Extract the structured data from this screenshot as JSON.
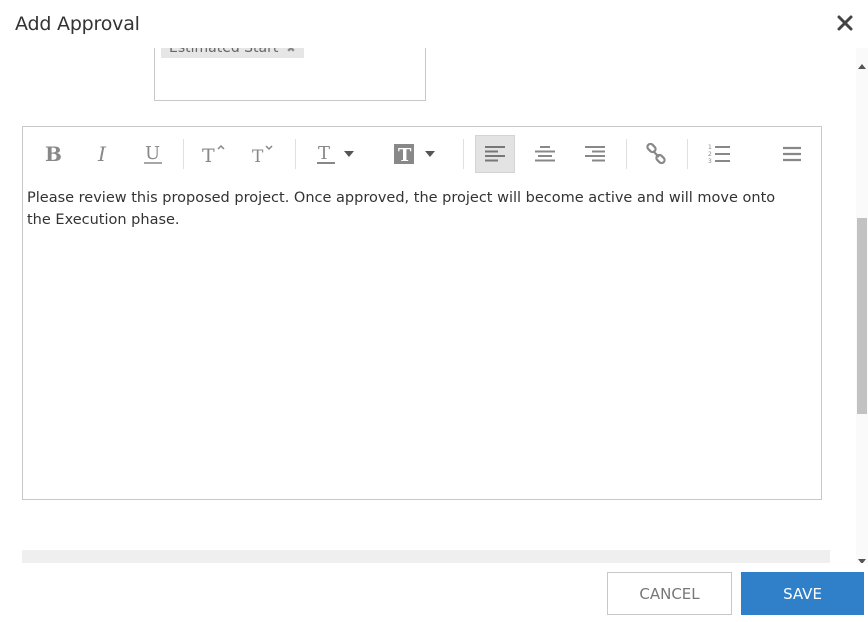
{
  "dialog": {
    "title": "Add Approval",
    "close_icon": "close-icon"
  },
  "tags": [
    {
      "label": "Estimated Start",
      "remove_icon": "close-small-icon"
    }
  ],
  "editor": {
    "toolbar": [
      {
        "name": "bold-icon"
      },
      {
        "name": "italic-icon"
      },
      {
        "name": "underline-icon"
      },
      {
        "name": "superscript-icon"
      },
      {
        "name": "subscript-icon"
      },
      {
        "name": "font-color-icon"
      },
      {
        "name": "background-color-icon"
      },
      {
        "name": "align-left-icon",
        "active": true
      },
      {
        "name": "align-center-icon"
      },
      {
        "name": "align-right-icon"
      },
      {
        "name": "link-icon"
      },
      {
        "name": "ordered-list-icon"
      },
      {
        "name": "more-icon"
      }
    ],
    "content": "Please review this proposed project. Once approved, the project will become active and will move onto the Execution phase."
  },
  "footer": {
    "cancel_label": "CANCEL",
    "save_label": "SAVE"
  },
  "colors": {
    "primary": "#2f80c8",
    "border": "#c8c8c8",
    "active_button": "#e3e3e3"
  }
}
